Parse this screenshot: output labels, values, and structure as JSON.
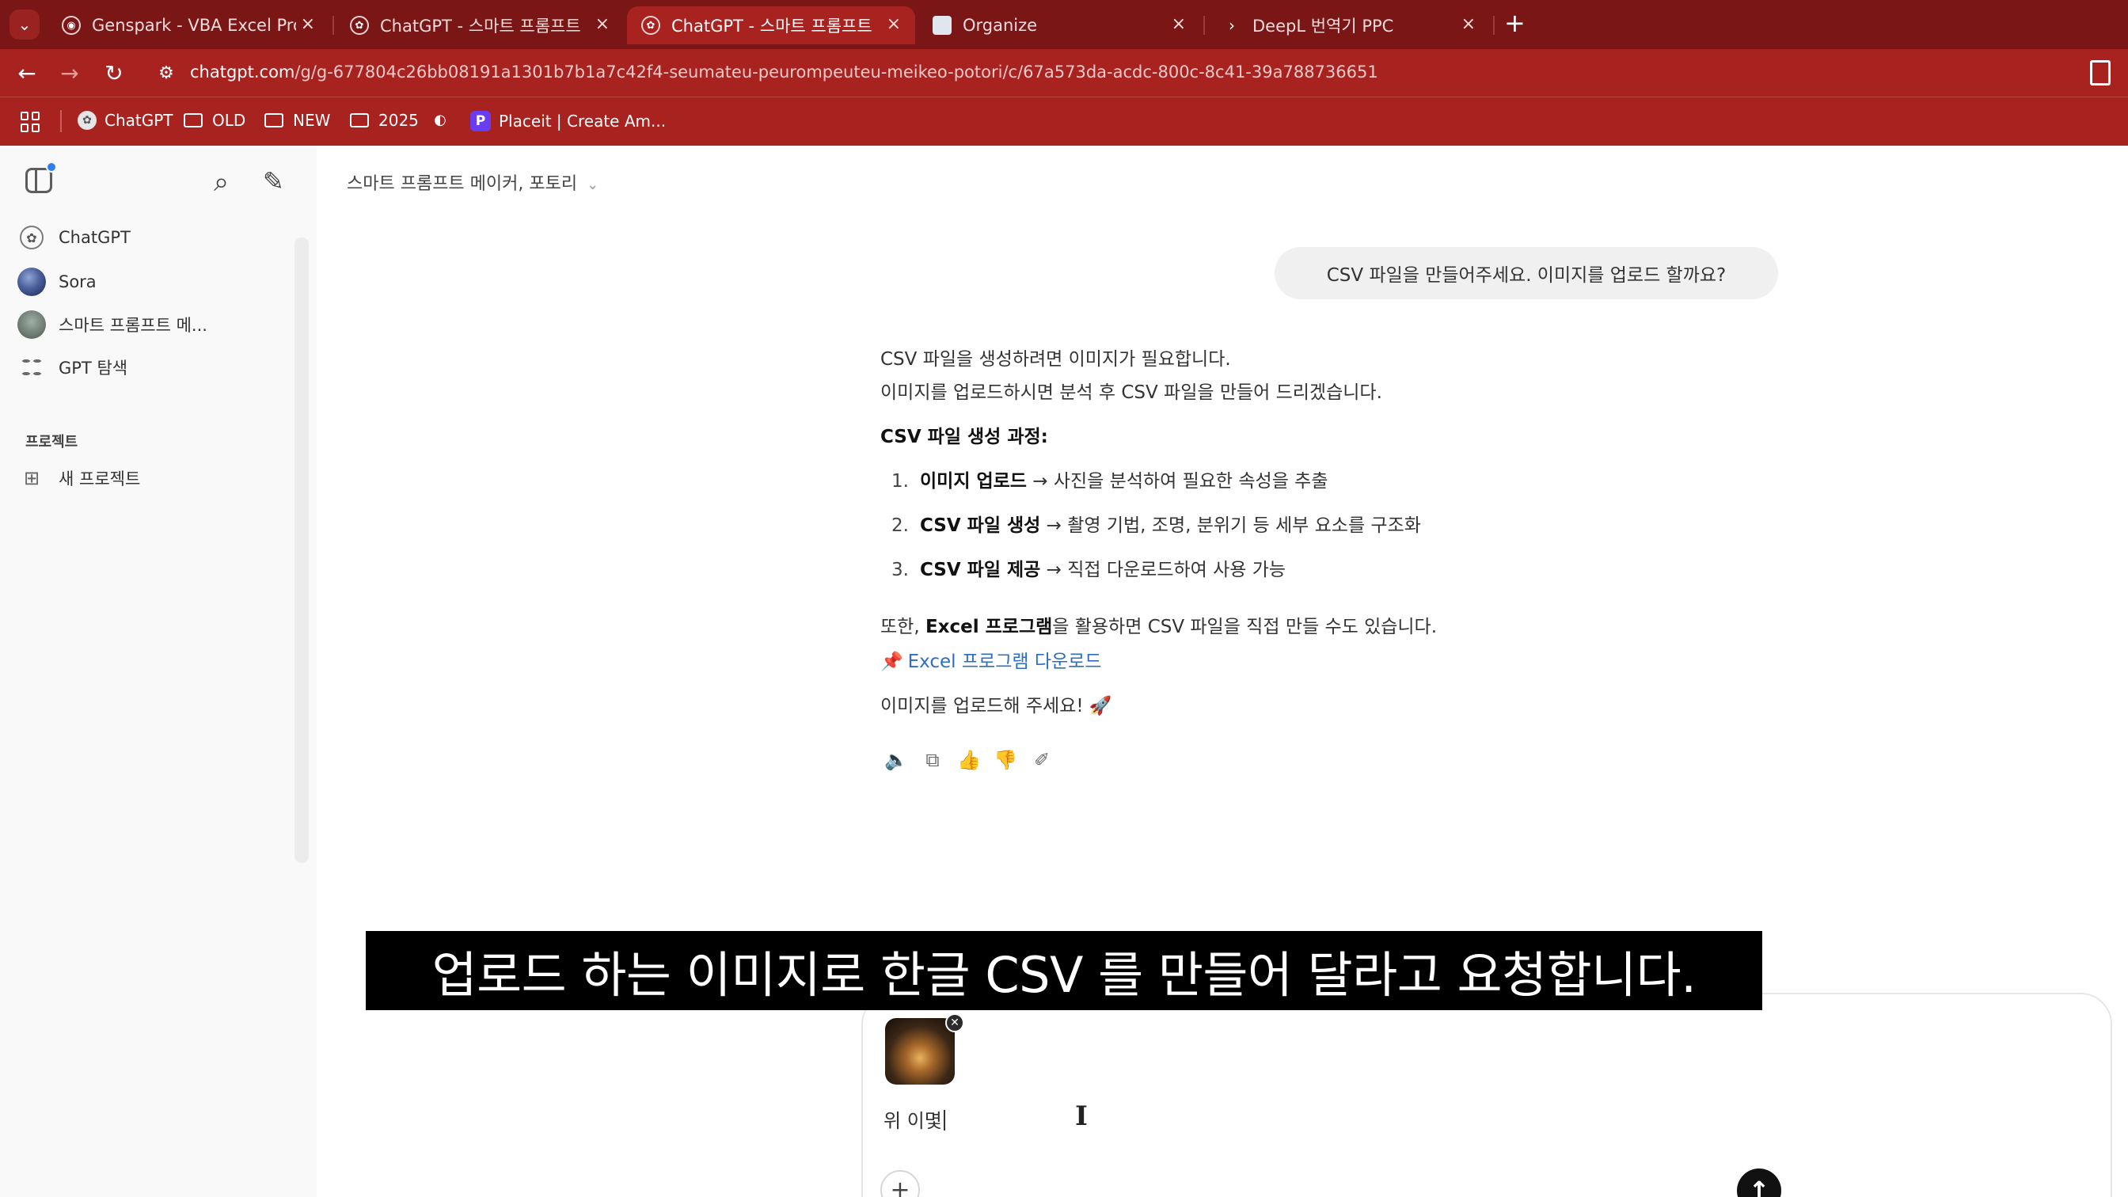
{
  "browser": {
    "tabs": [
      {
        "label": "Genspark - VBA Excel Program",
        "active": false
      },
      {
        "label": "ChatGPT - 스마트 프롬프트 메",
        "active": false
      },
      {
        "label": "ChatGPT - 스마트 프롬프트 메",
        "active": true
      },
      {
        "label": "Organize",
        "active": false
      },
      {
        "label": "DeepL 번역기 PPC",
        "active": false
      }
    ],
    "url_host": "chatgpt.com",
    "url_path": "/g/g-677804c26bb08191a1301b7b1a7c42f4-seumateu-peurompeuteu-meikeo-potori/c/67a573da-acdc-800c-8c41-39a788736651",
    "bookmarks": [
      "ChatGPT",
      "OLD",
      "NEW",
      "2025",
      "Placeit | Create Am..."
    ]
  },
  "sidebar": {
    "items": [
      {
        "label": "ChatGPT",
        "icon": "openai-icon"
      },
      {
        "label": "Sora",
        "icon": "sora-avatar"
      },
      {
        "label": "스마트 프롬프트 메...",
        "icon": "smart-prompt-avatar"
      },
      {
        "label": "GPT 탐색",
        "icon": "explore-grid-icon"
      }
    ],
    "section_title": "프로젝트",
    "new_project": "새 프로젝트"
  },
  "main": {
    "model_title": "스마트 프롬프트 메이커, 포토리",
    "user_message": "CSV 파일을 만들어주세요. 이미지를 업로드 할까요?",
    "assistant": {
      "line1": "CSV 파일을 생성하려면 이미지가 필요합니다.",
      "line2": "이미지를 업로드하시면 분석 후 CSV 파일을 만들어 드리겠습니다.",
      "process_title": "CSV 파일 생성 과정:",
      "steps": [
        {
          "num": "1.",
          "bold": "이미지 업로드",
          "rest": " → 사진을 분석하여 필요한 속성을 추출"
        },
        {
          "num": "2.",
          "bold": "CSV 파일 생성",
          "rest": " → 촬영 기법, 조명, 분위기 등 세부 요소를 구조화"
        },
        {
          "num": "3.",
          "bold": "CSV 파일 제공",
          "rest": " → 직접 다운로드하여 사용 가능"
        }
      ],
      "excel_pre": "또한, ",
      "excel_bold": "Excel 프로그램",
      "excel_post": "을 활용하면 CSV 파일을 직접 만들 수도 있습니다.",
      "link_pin": "📌",
      "link_text": "Excel 프로그램 다운로드",
      "closing": "이미지를 업로드해 주세요!",
      "closing_emoji": "🚀"
    },
    "composer": {
      "input_value": "위 이몇",
      "remove_icon": "✕"
    }
  },
  "caption": "업로드 하는 이미지로 한글 CSV 를 만들어 달라고 요청합니다."
}
